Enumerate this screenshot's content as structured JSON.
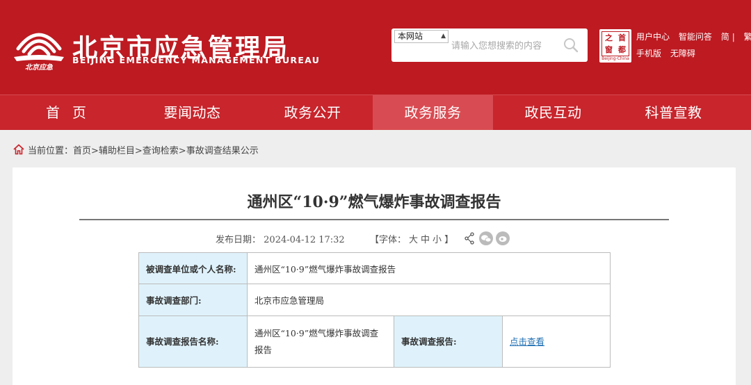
{
  "header": {
    "site_name": "北京市应急管理局",
    "site_name_en": "BEIJING EMERGENCY MANAGEMENT BUREAU",
    "logo_text": "北京应急",
    "search": {
      "scope": "本网站",
      "placeholder": "请输入您想搜索的内容"
    },
    "capital_badge": {
      "chars": [
        "首",
        "都",
        "之",
        "窗"
      ],
      "text_en": "Beijing-China"
    },
    "links_row1": [
      "用户中心",
      "智能问答",
      "简",
      "繁"
    ],
    "links_row2": [
      "手机版",
      "无障碍"
    ]
  },
  "nav": {
    "items": [
      "首页",
      "要闻动态",
      "政务公开",
      "政务服务",
      "政民互动",
      "科普宣教"
    ],
    "active": "政务服务"
  },
  "breadcrumb": {
    "label": "当前位置：",
    "path": "首页>辅助栏目>查询检索>事故调查结果公示"
  },
  "article": {
    "title": "通州区“10·9”燃气爆炸事故调查报告",
    "publish_label": "发布日期：",
    "publish_date": "2024-04-12 17:32",
    "font_label_open": "【字体：",
    "font_sizes": [
      "大",
      "中",
      "小"
    ],
    "font_label_close": "】"
  },
  "table": {
    "row1": {
      "label": "被调查单位或个人名称:",
      "value": "通州区“10·9”燃气爆炸事故调查报告"
    },
    "row2": {
      "label": "事故调查部门:",
      "value": "北京市应急管理局"
    },
    "row3": {
      "label": "事故调查报告名称:",
      "value": "通州区“10·9”燃气爆炸事故调查报告",
      "label2": "事故调查报告:",
      "link": "点击查看"
    }
  },
  "colors": {
    "brand_red": "#bd1a22",
    "nav_red": "#c8252c",
    "nav_active": "#d94b52",
    "label_bg": "#dff2fb",
    "link": "#1f6fb2"
  }
}
